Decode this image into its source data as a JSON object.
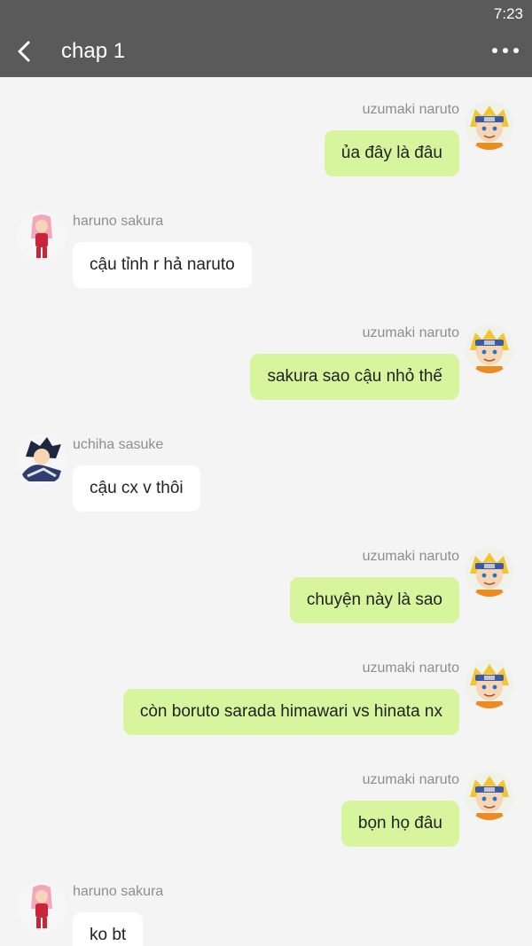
{
  "status": {
    "time": "7:23"
  },
  "header": {
    "title": "chap 1",
    "back_icon": "chevron-left-icon",
    "menu_icon": "more-horizontal-icon"
  },
  "colors": {
    "header_bg": "#5a5a5a",
    "sent_bubble": "#d7f59c",
    "received_bubble": "#ffffff",
    "background": "#f4f4f4"
  },
  "messages": [
    {
      "side": "right",
      "sender": "uzumaki naruto",
      "text": "ủa đây là đâu",
      "avatar": "naruto-avatar"
    },
    {
      "side": "left",
      "sender": "haruno sakura",
      "text": "cậu tỉnh r hả naruto",
      "avatar": "sakura-avatar"
    },
    {
      "side": "right",
      "sender": "uzumaki naruto",
      "text": "sakura sao cậu nhỏ thế",
      "avatar": "naruto-avatar"
    },
    {
      "side": "left",
      "sender": "uchiha sasuke",
      "text": "cậu cx v thôi",
      "avatar": "sasuke-avatar"
    },
    {
      "side": "right",
      "sender": "uzumaki naruto",
      "text": "chuyện này là sao",
      "avatar": "naruto-avatar"
    },
    {
      "side": "right",
      "sender": "uzumaki naruto",
      "text": "còn boruto sarada himawari vs hinata nx",
      "avatar": "naruto-avatar"
    },
    {
      "side": "right",
      "sender": "uzumaki naruto",
      "text": "bọn họ đâu",
      "avatar": "naruto-avatar"
    },
    {
      "side": "left",
      "sender": "haruno sakura",
      "text": "ko bt",
      "avatar": "sakura-avatar"
    }
  ]
}
